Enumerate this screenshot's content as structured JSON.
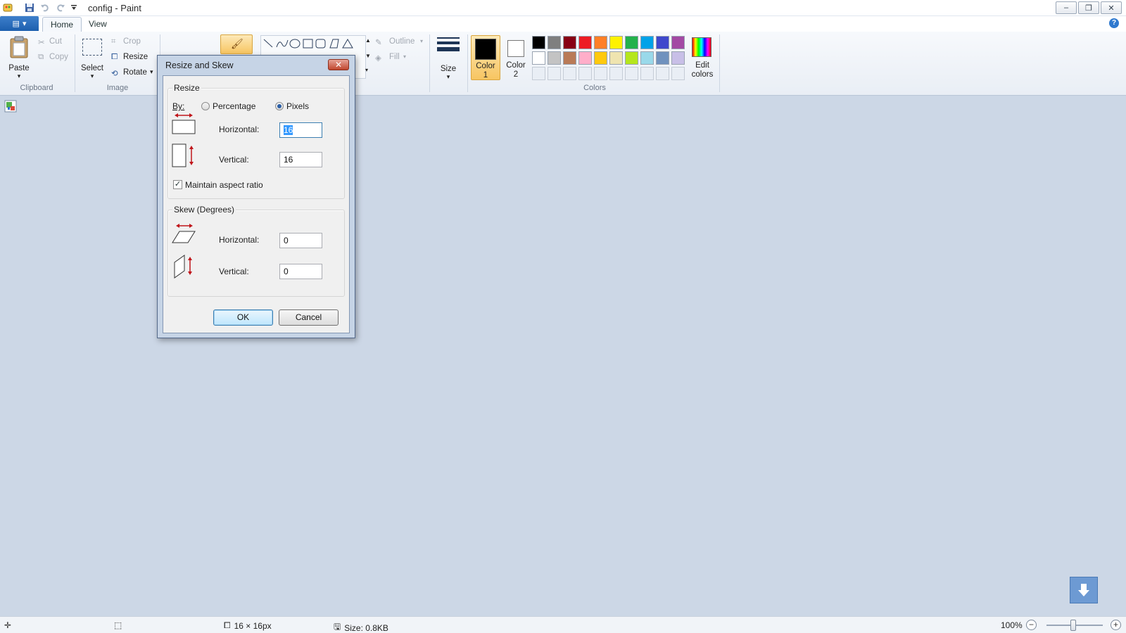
{
  "window": {
    "title": "config - Paint",
    "controls": {
      "minimize": "–",
      "restore": "❐",
      "close": "✕"
    }
  },
  "ribbon": {
    "tabs": [
      {
        "label": "Home",
        "active": true
      },
      {
        "label": "View",
        "active": false
      }
    ],
    "clipboard": {
      "group_label": "Clipboard",
      "paste": "Paste",
      "cut": "Cut",
      "copy": "Copy"
    },
    "image": {
      "group_label": "Image",
      "select": "Select",
      "crop": "Crop",
      "resize": "Resize",
      "rotate": "Rotate"
    },
    "shapes": {
      "outline": "Outline",
      "fill": "Fill"
    },
    "size_label": "Size",
    "colors": {
      "group_label": "Colors",
      "color1": {
        "label1": "Color",
        "label2": "1",
        "value": "#000000"
      },
      "color2": {
        "label1": "Color",
        "label2": "2",
        "value": "#ffffff"
      },
      "edit1": "Edit",
      "edit2": "colors",
      "palette_row1": [
        "#000000",
        "#7f7f7f",
        "#880015",
        "#ed1c24",
        "#ff7f27",
        "#fff200",
        "#22b14c",
        "#00a2e8",
        "#3f48cc",
        "#a349a4"
      ],
      "palette_row2": [
        "#ffffff",
        "#c3c3c3",
        "#b97a57",
        "#ffaec9",
        "#ffc90e",
        "#efe4b0",
        "#b5e61d",
        "#99d9ea",
        "#7092be",
        "#c8bfe7"
      ]
    }
  },
  "dialog": {
    "title": "Resize and Skew",
    "close": "✕",
    "resize": {
      "legend": "Resize",
      "by_label": "By:",
      "percentage_label": "Percentage",
      "pixels_label": "Pixels",
      "selected_unit": "Pixels",
      "horizontal_label": "Horizontal:",
      "horizontal_value": "16",
      "vertical_label": "Vertical:",
      "vertical_value": "16",
      "maintain_label": "Maintain aspect ratio",
      "maintain_checked": true
    },
    "skew": {
      "legend": "Skew (Degrees)",
      "horizontal_label": "Horizontal:",
      "horizontal_value": "0",
      "vertical_label": "Vertical:",
      "vertical_value": "0"
    },
    "ok": "OK",
    "cancel": "Cancel"
  },
  "statusbar": {
    "dimensions": "16 × 16px",
    "size": "Size: 0.8KB",
    "zoom": "100%"
  }
}
